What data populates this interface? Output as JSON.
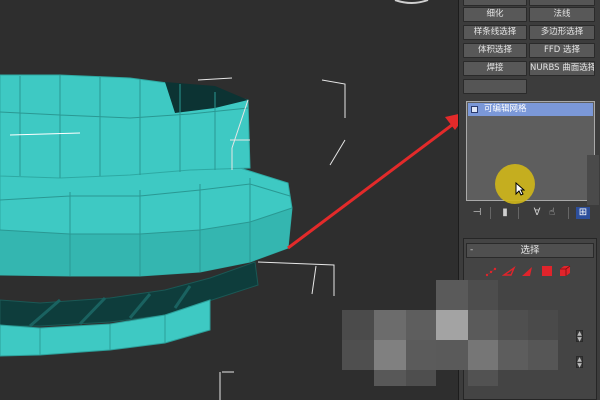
{
  "modifier_buttons": {
    "tessellate": "细化",
    "normal": "法线",
    "spline_select": "样条线选择",
    "poly_select": "多边形选择",
    "volume_select": "体积选择",
    "ffd_select": "FFD 选择",
    "weld": "焊接",
    "nurbs_surface_select": "NURBS 曲面选择"
  },
  "modifier_stack": {
    "items": [
      {
        "label": "可编辑网格",
        "selected": true
      }
    ]
  },
  "rollout": {
    "title": "选择",
    "collapse_symbol": "-"
  },
  "colors": {
    "mesh": "#3ec9c3",
    "mesh_dark": "#0d3c3b",
    "viewport_bg": "#2e2e2e",
    "annotation_arrow": "#e32a2a",
    "selection_highlight": "#7b98d8",
    "cursor_halo": "#ceb51a",
    "subobject_icons": "#e0242b"
  },
  "icons": {
    "stack_toolbar": [
      "pin-stack-icon",
      "show-end-result-icon",
      "make-unique-icon",
      "remove-modifier-icon",
      "configure-sets-icon"
    ],
    "subobjects": [
      "vertex-icon",
      "edge-icon",
      "face-icon",
      "polygon-icon",
      "element-icon"
    ]
  }
}
